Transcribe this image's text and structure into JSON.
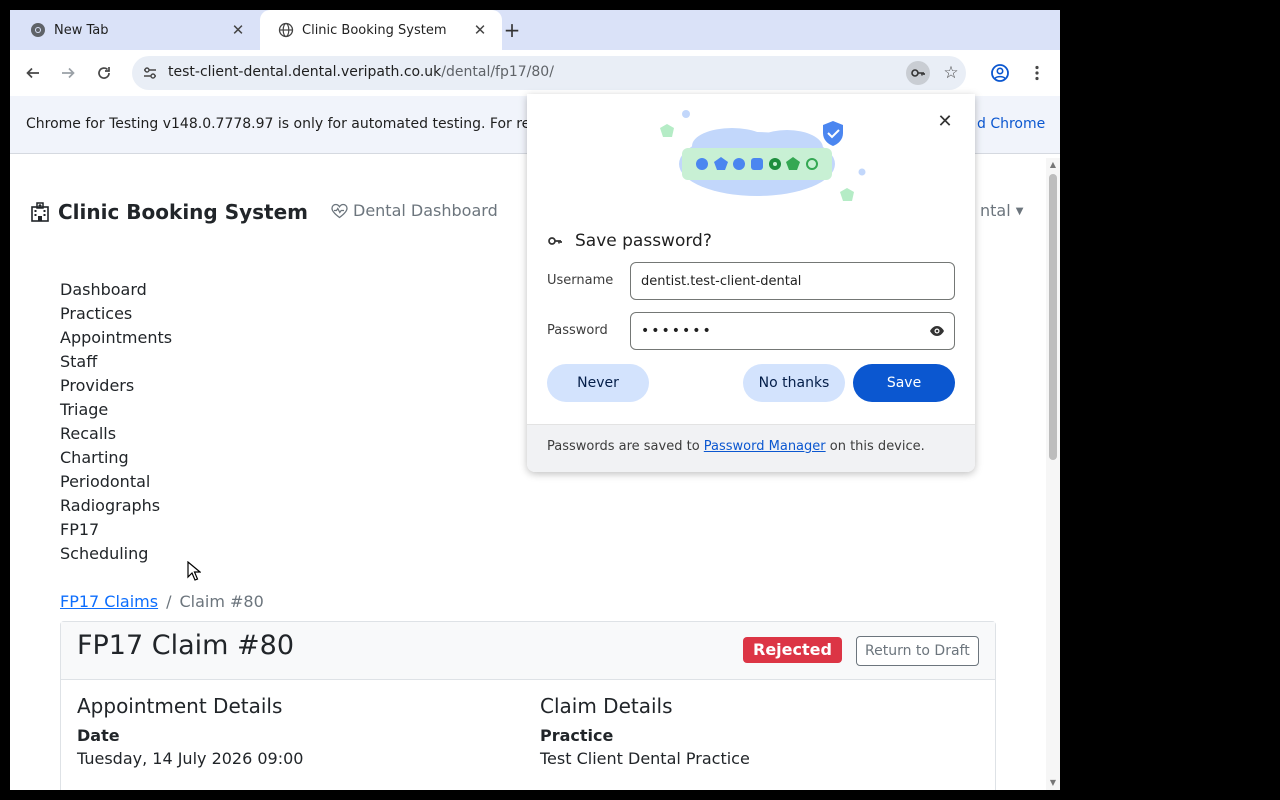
{
  "browser": {
    "tabs": [
      {
        "title": "New Tab"
      },
      {
        "title": "Clinic Booking System"
      }
    ],
    "url_host": "test-client-dental.dental.veripath.co.uk",
    "url_path": "/dental/fp17/80/",
    "infobar_text": "Chrome for Testing v148.0.7778.97 is only for automated testing. For re",
    "infobar_link": "d Chrome"
  },
  "app": {
    "brand": "Clinic Booking System",
    "dashboard_link": "Dental Dashboard",
    "user_menu": "ntal",
    "nav": [
      "Dashboard",
      "Practices",
      "Appointments",
      "Staff",
      "Providers",
      "Triage",
      "Recalls",
      "Charting",
      "Periodontal",
      "Radiographs",
      "FP17",
      "Scheduling"
    ],
    "breadcrumb": {
      "parent": "FP17 Claims",
      "sep": "/",
      "current": "Claim #80"
    },
    "claim": {
      "title": "FP17 Claim #80",
      "status": "Rejected",
      "return_button": "Return to Draft",
      "appointment": {
        "heading": "Appointment Details",
        "date_label": "Date",
        "date_value": "Tuesday, 14 July 2026 09:00"
      },
      "details": {
        "heading": "Claim Details",
        "practice_label": "Practice",
        "practice_value": "Test Client Dental Practice"
      }
    }
  },
  "dialog": {
    "title": "Save password?",
    "username_label": "Username",
    "username_value": "dentist.test-client-dental",
    "password_label": "Password",
    "password_value": "•••••••",
    "never": "Never",
    "no_thanks": "No thanks",
    "save": "Save",
    "footer_pre": "Passwords are saved to ",
    "footer_link": "Password Manager",
    "footer_post": " on this device."
  },
  "colors": {
    "badge_danger": "#dc3545",
    "save_button": "#0b57d0",
    "link": "#0d6efd"
  }
}
